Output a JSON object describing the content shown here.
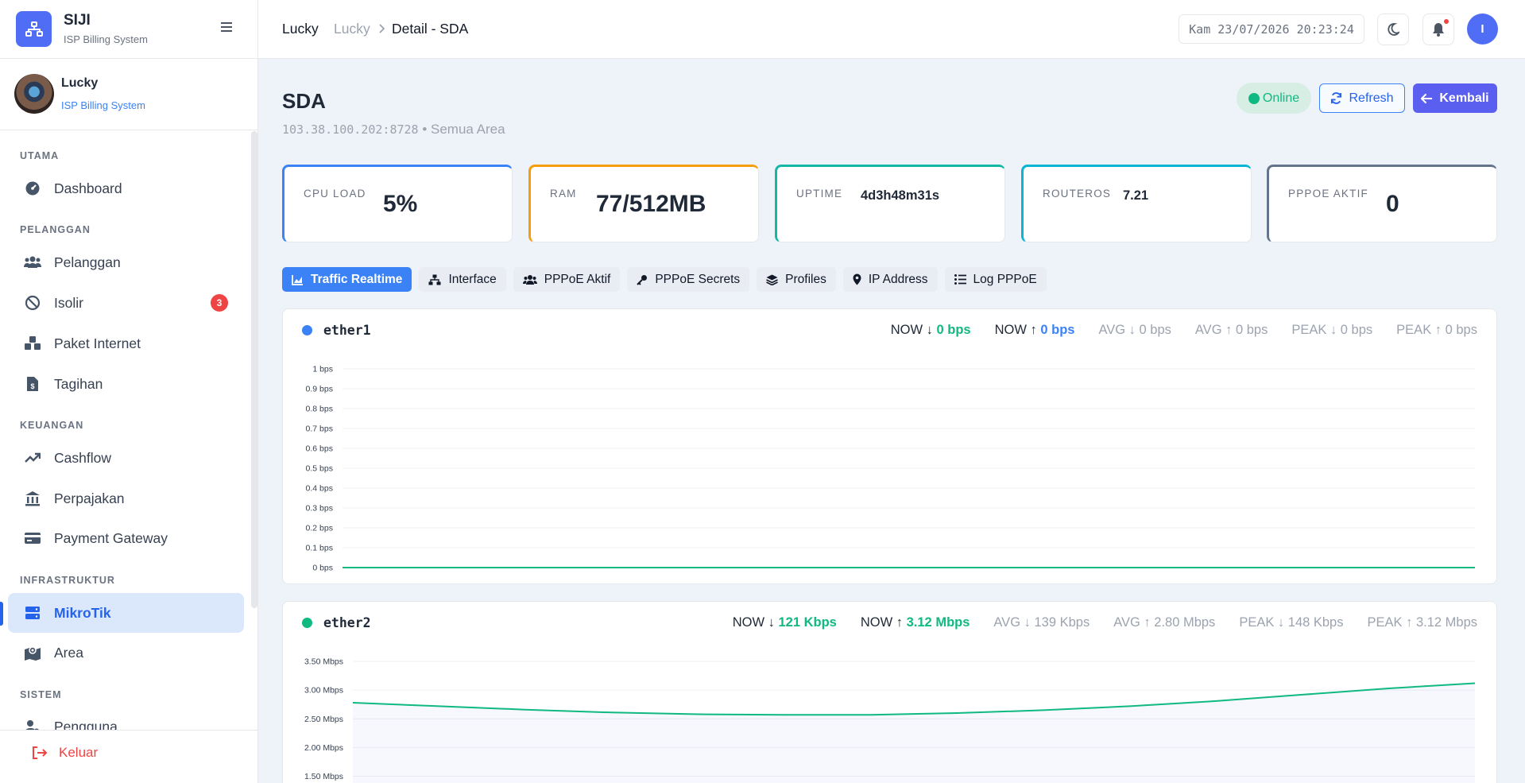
{
  "app": {
    "name": "SIJI",
    "subtitle": "ISP Billing System"
  },
  "profile": {
    "name": "Lucky",
    "role": "ISP Billing System"
  },
  "nav": {
    "sections": [
      "UTAMA",
      "PELANGGAN",
      "KEUANGAN",
      "INFRASTRUKTUR",
      "SISTEM"
    ],
    "items": [
      {
        "label": "Dashboard",
        "icon": "gauge-icon"
      },
      {
        "label": "Pelanggan",
        "icon": "users-icon"
      },
      {
        "label": "Isolir",
        "icon": "ban-icon",
        "badge": "3"
      },
      {
        "label": "Paket Internet",
        "icon": "cubes-icon"
      },
      {
        "label": "Tagihan",
        "icon": "invoice-icon"
      },
      {
        "label": "Cashflow",
        "icon": "trend-icon"
      },
      {
        "label": "Perpajakan",
        "icon": "bank-icon"
      },
      {
        "label": "Payment Gateway",
        "icon": "card-icon"
      },
      {
        "label": "MikroTik",
        "icon": "server-icon",
        "active": true
      },
      {
        "label": "Area",
        "icon": "map-icon"
      },
      {
        "label": "Pengguna",
        "icon": "user-gear-icon"
      }
    ],
    "logout": "Keluar"
  },
  "topbar": {
    "breadcrumb": [
      "Lucky",
      "Lucky",
      "Detail - SDA"
    ],
    "clock": "Kam 23/07/2026 20:23:24",
    "user_initial": "I"
  },
  "page": {
    "title": "SDA",
    "subtitle_ip": "103.38.100.202:8728",
    "subtitle_sep": "•",
    "subtitle_area": "Semua Area",
    "status": "Online",
    "refresh_label": "Refresh",
    "back_label": "Kembali"
  },
  "stats": [
    {
      "label": "CPU LOAD",
      "value": "5%",
      "color": "#3b82f6"
    },
    {
      "label": "RAM",
      "value": "77/512MB",
      "color": "#f59e0b"
    },
    {
      "label": "UPTIME",
      "value": "4d3h48m31s",
      "color": "#14b8a6"
    },
    {
      "label": "ROUTEROS",
      "value": "7.21",
      "color": "#06b6d4"
    },
    {
      "label": "PPPOE AKTIF",
      "value": "0",
      "color": "#64748b"
    }
  ],
  "tabs": [
    "Traffic Realtime",
    "Interface",
    "PPPoE Aktif",
    "PPPoE Secrets",
    "Profiles",
    "IP Address",
    "Log PPPoE"
  ],
  "metric_labels": {
    "now_down": "NOW ↓",
    "now_up": "NOW ↑",
    "avg_down": "AVG ↓",
    "avg_up": "AVG ↑",
    "peak_down": "PEAK ↓",
    "peak_up": "PEAK ↑"
  },
  "interfaces": [
    {
      "name": "ether1",
      "dot_color": "#3b82f6",
      "now_down": "0 bps",
      "now_up": "0 bps",
      "avg_down": "0 bps",
      "avg_up": "0 bps",
      "peak_down": "0 bps",
      "peak_up": "0 bps"
    },
    {
      "name": "ether2",
      "dot_color": "#10b981",
      "now_down": "121 Kbps",
      "now_up": "3.12 Mbps",
      "avg_down": "139 Kbps",
      "avg_up": "2.80 Mbps",
      "peak_down": "148 Kbps",
      "peak_up": "3.12 Mbps"
    }
  ],
  "chart_data": [
    {
      "type": "line",
      "title": "ether1",
      "y_ticks": [
        "0 bps",
        "0.1 bps",
        "0.2 bps",
        "0.3 bps",
        "0.4 bps",
        "0.5 bps",
        "0.6 bps",
        "0.7 bps",
        "0.8 bps",
        "0.9 bps",
        "1 bps"
      ],
      "ylim": [
        0,
        1
      ],
      "series": [
        {
          "values": [
            0,
            0,
            0,
            0,
            0,
            0,
            0,
            0,
            0,
            0,
            0
          ],
          "color": "#10b981"
        }
      ]
    },
    {
      "type": "line",
      "title": "ether2",
      "y_ticks_visible": [
        "1.50 Mbps",
        "2.00 Mbps",
        "2.50 Mbps",
        "3.00 Mbps",
        "3.50 Mbps"
      ],
      "ylim": [
        1.5,
        3.5
      ],
      "unit": "Mbps",
      "series": [
        {
          "values": [
            2.78,
            2.72,
            2.66,
            2.61,
            2.58,
            2.57,
            2.57,
            2.6,
            2.65,
            2.72,
            2.81,
            2.92,
            3.03,
            3.12
          ],
          "color": "#10b981"
        }
      ]
    }
  ]
}
